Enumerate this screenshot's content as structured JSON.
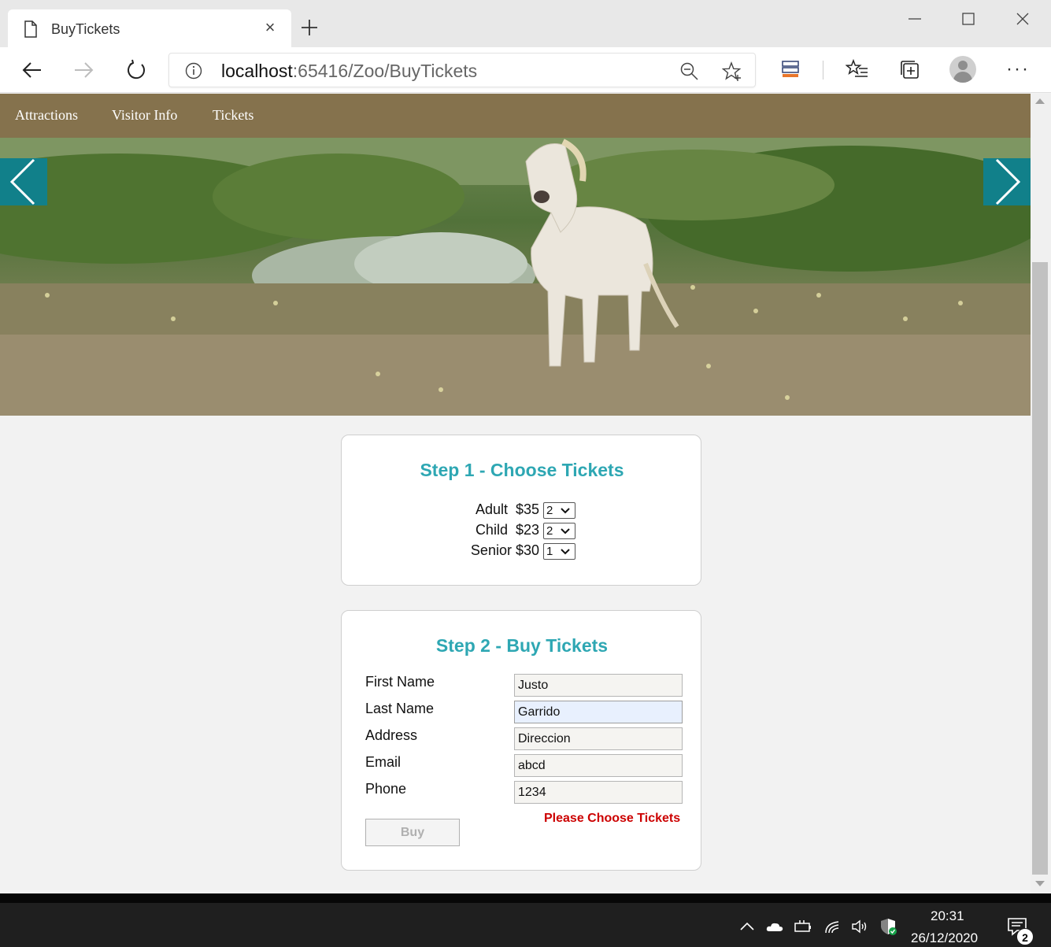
{
  "browser": {
    "tab_title": "BuyTickets",
    "tab_close": "×",
    "url_host": "localhost",
    "url_path": ":65416/Zoo/BuyTickets",
    "more_label": "···"
  },
  "site_nav": {
    "items": [
      {
        "label": "Attractions"
      },
      {
        "label": "Visitor Info"
      },
      {
        "label": "Tickets"
      }
    ],
    "background": "#85724d"
  },
  "step1": {
    "title": "Step 1 - Choose Tickets",
    "rows": [
      {
        "label": "Adult  $35",
        "quantity": "2"
      },
      {
        "label": "Child  $23",
        "quantity": "2"
      },
      {
        "label": "Senior $30",
        "quantity": "1"
      }
    ]
  },
  "step2": {
    "title": "Step 2 - Buy Tickets",
    "fields": [
      {
        "label": "First Name",
        "value": "Justo"
      },
      {
        "label": "Last Name",
        "value": "Garrido"
      },
      {
        "label": "Address",
        "value": "Direccion"
      },
      {
        "label": "Email",
        "value": "abcd"
      },
      {
        "label": "Phone",
        "value": "1234"
      }
    ],
    "error": "Please Choose Tickets",
    "buy_label": "Buy"
  },
  "taskbar": {
    "time": "20:31",
    "date": "26/12/2020",
    "notification_count": "2"
  },
  "colors": {
    "accent": "#2ea7b3",
    "carousel": "#11808a",
    "error": "#cc0000"
  }
}
